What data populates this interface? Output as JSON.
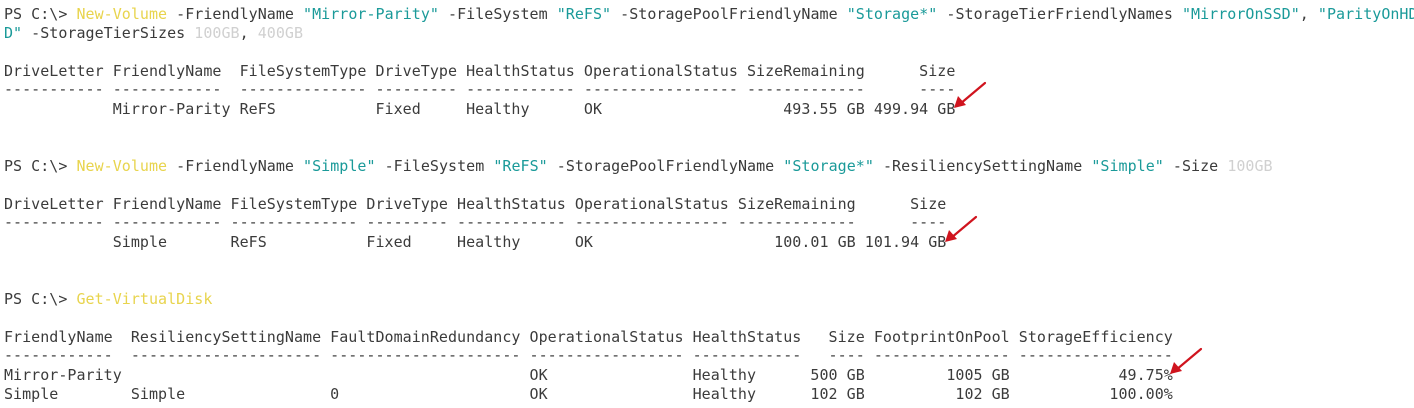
{
  "terminal": {
    "block1": {
      "prompt": "PS C:\\> ",
      "cmd": "New-Volume",
      "p1": " -FriendlyName ",
      "s1": "\"Mirror-Parity\"",
      "p2": " -FileSystem ",
      "s2": "\"ReFS\"",
      "p3": " -StoragePoolFriendlyName ",
      "s3": "\"Storage*\"",
      "p4": " -StorageTierFriendlyNames ",
      "s4": "\"MirrorOnSSD\"",
      "c1": ", ",
      "s5a": "\"ParityOnHD",
      "s5b": "D\"",
      "p5": " -StorageTierSizes ",
      "n1": "100GB",
      "c2": ", ",
      "n2": "400GB",
      "header": "DriveLetter FriendlyName  FileSystemType DriveType HealthStatus OperationalStatus SizeRemaining      Size",
      "rule": "----------- ------------  -------------- --------- ------------ ----------------- -------------      ----",
      "row": "            Mirror-Parity ReFS           Fixed     Healthy      OK                    493.55 GB 499.94 GB"
    },
    "block2": {
      "prompt": "PS C:\\> ",
      "cmd": "New-Volume",
      "p1": " -FriendlyName ",
      "s1": "\"Simple\"",
      "p2": " -FileSystem ",
      "s2": "\"ReFS\"",
      "p3": " -StoragePoolFriendlyName ",
      "s3": "\"Storage*\"",
      "p4": " -ResiliencySettingName ",
      "s4": "\"Simple\"",
      "p5": " -Size ",
      "n1": "100GB",
      "header": "DriveLetter FriendlyName FileSystemType DriveType HealthStatus OperationalStatus SizeRemaining      Size",
      "rule": "----------- ------------ -------------- --------- ------------ ----------------- -------------      ----",
      "row": "            Simple       ReFS           Fixed     Healthy      OK                    100.01 GB 101.94 GB"
    },
    "block3": {
      "prompt": "PS C:\\> ",
      "cmd": "Get-VirtualDisk",
      "header": "FriendlyName  ResiliencySettingName FaultDomainRedundancy OperationalStatus HealthStatus   Size FootprintOnPool StorageEfficiency",
      "rule": "------------  --------------------- --------------------- ----------------- ------------   ---- --------------- -----------------",
      "row1": "Mirror-Parity                                             OK                Healthy      500 GB         1005 GB            49.75%",
      "row2": "Simple        Simple                0                     OK                Healthy      102 GB          102 GB           100.00%"
    },
    "arrow_color": "#d0141e"
  }
}
